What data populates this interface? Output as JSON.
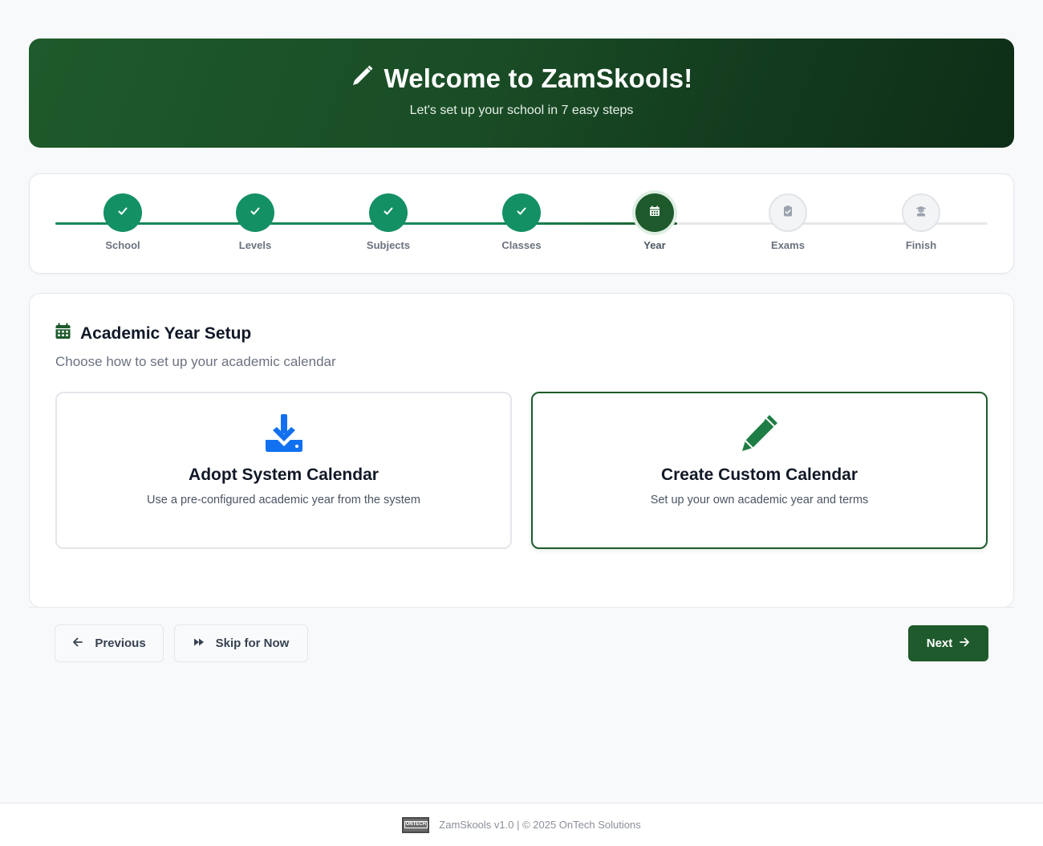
{
  "banner": {
    "title": "Welcome to ZamSkools!",
    "subtitle": "Let's set up your school in 7 easy steps"
  },
  "stepper": {
    "steps": [
      {
        "label": "School",
        "state": "done",
        "icon": "check-icon"
      },
      {
        "label": "Levels",
        "state": "done",
        "icon": "check-icon"
      },
      {
        "label": "Subjects",
        "state": "done",
        "icon": "check-icon"
      },
      {
        "label": "Classes",
        "state": "done",
        "icon": "check-icon"
      },
      {
        "label": "Year",
        "state": "active",
        "icon": "calendar-icon"
      },
      {
        "label": "Exams",
        "state": "pending",
        "icon": "clipboard-check-icon"
      },
      {
        "label": "Finish",
        "state": "pending",
        "icon": "graduate-icon"
      }
    ]
  },
  "section": {
    "title": "Academic Year Setup",
    "subtitle": "Choose how to set up your academic calendar"
  },
  "options": {
    "adopt": {
      "title": "Adopt System Calendar",
      "description": "Use a pre-configured academic year from the system",
      "icon": "download-icon",
      "icon_color": "#1170f0"
    },
    "custom": {
      "title": "Create Custom Calendar",
      "description": "Set up your own academic year and terms",
      "icon": "pencil-icon",
      "icon_color": "#1e7d45",
      "selected": true
    }
  },
  "nav": {
    "previous_label": "Previous",
    "skip_label": "Skip for Now",
    "next_label": "Next"
  },
  "footer": {
    "logo_text": "ONTECH",
    "text": "ZamSkools v1.0 | © 2025 OnTech Solutions"
  },
  "colors": {
    "primary": "#1e5a2b",
    "step_done": "#149065",
    "accent_blue": "#1170f0"
  }
}
